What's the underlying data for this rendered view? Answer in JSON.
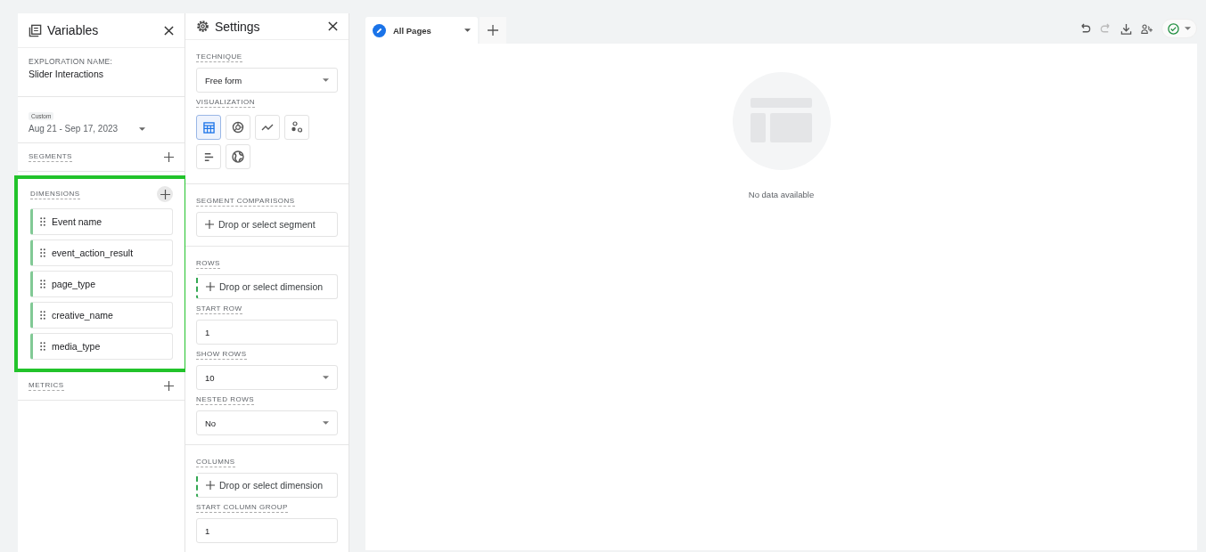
{
  "variables_panel": {
    "title": "Variables",
    "exploration_name_label": "EXPLORATION NAME:",
    "exploration_name": "Slider Interactions",
    "date_range": {
      "badge": "Custom",
      "value": "Aug 21 - Sep 17, 2023"
    },
    "segments": {
      "label": "SEGMENTS"
    },
    "dimensions": {
      "label": "DIMENSIONS",
      "highlighted": true,
      "items": [
        {
          "label": "Event name"
        },
        {
          "label": "event_action_result"
        },
        {
          "label": "page_type"
        },
        {
          "label": "creative_name"
        },
        {
          "label": "media_type"
        }
      ]
    },
    "metrics": {
      "label": "METRICS"
    }
  },
  "settings_panel": {
    "title": "Settings",
    "groups": [
      [
        {
          "kind": "dropdown",
          "label": "TECHNIQUE",
          "value": "Free form"
        },
        {
          "kind": "visualization",
          "label": "VISUALIZATION",
          "options": [
            {
              "kind": "table",
              "selected": true
            },
            {
              "kind": "donut",
              "selected": false
            },
            {
              "kind": "line",
              "selected": false
            },
            {
              "kind": "scatter",
              "selected": false
            },
            {
              "kind": "bar",
              "selected": false
            },
            {
              "kind": "geo",
              "selected": false
            }
          ]
        }
      ],
      [
        {
          "kind": "drop",
          "label": "SEGMENT COMPARISONS",
          "placeholder": "Drop or select segment",
          "dashed": false
        }
      ],
      [
        {
          "kind": "drop",
          "label": "ROWS",
          "placeholder": "Drop or select dimension",
          "dashed": true
        },
        {
          "kind": "input",
          "label": "START ROW",
          "value": "1"
        },
        {
          "kind": "dropdown",
          "label": "SHOW ROWS",
          "value": "10"
        },
        {
          "kind": "dropdown",
          "label": "NESTED ROWS",
          "value": "No"
        }
      ],
      [
        {
          "kind": "drop",
          "label": "COLUMNS",
          "placeholder": "Drop or select dimension",
          "dashed": true
        },
        {
          "kind": "input",
          "label": "START COLUMN GROUP",
          "value": "1"
        }
      ]
    ]
  },
  "tabs": [
    {
      "label": "All Pages",
      "selected": true
    }
  ],
  "canvas": {
    "empty_message": "No data available"
  }
}
